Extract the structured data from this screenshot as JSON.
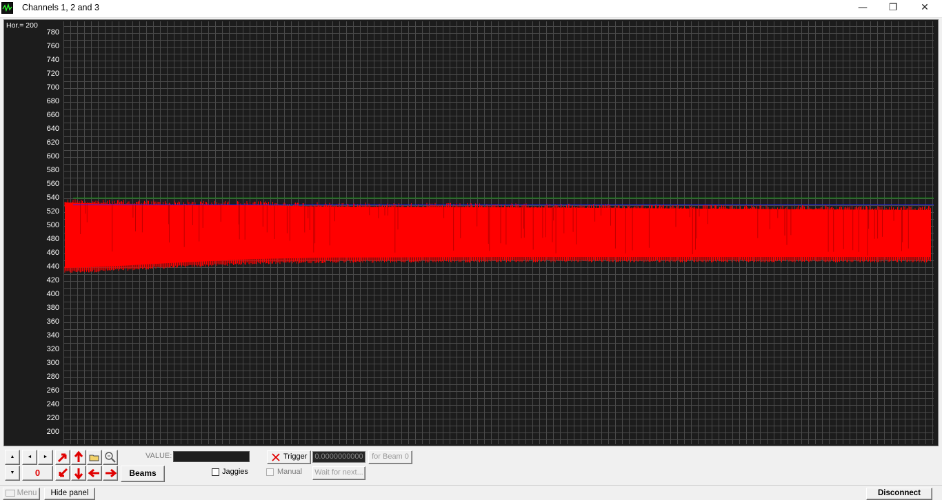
{
  "window": {
    "title": "Channels 1, 2 and 3",
    "icon": "oscilloscope-icon",
    "minimize_glyph": "—",
    "restore_glyph": "❐",
    "close_glyph": "✕"
  },
  "scope": {
    "hor_label": "Hor.= 200",
    "y_ticks": [
      "780",
      "760",
      "740",
      "720",
      "700",
      "680",
      "660",
      "640",
      "620",
      "600",
      "580",
      "560",
      "540",
      "520",
      "500",
      "480",
      "460",
      "440",
      "420",
      "400",
      "380",
      "360",
      "340",
      "320",
      "300",
      "280",
      "260",
      "240",
      "220",
      "200"
    ],
    "background_color": "#1c1c1c",
    "grid_color": "#4a4a4a",
    "chart_data": {
      "type": "line",
      "y_range": [
        190,
        790
      ],
      "grid": true,
      "series": [
        {
          "color": "#ff0000",
          "band_min": [
            431,
            433,
            438,
            444,
            446,
            447,
            447,
            447
          ],
          "band_max": [
            540,
            538,
            537,
            536,
            534,
            533,
            531,
            529
          ],
          "band_x": [
            0,
            0.05,
            0.12,
            0.22,
            0.3,
            0.5,
            0.75,
            1.0
          ]
        },
        {
          "color": "#00b000",
          "level": 541
        },
        {
          "color": "#2020ff",
          "level": 531
        }
      ]
    }
  },
  "panel": {
    "beam_number": "0",
    "beams_label": "Beams",
    "value_label": "VALUE:",
    "jaggies_label": "Jaggies",
    "trigger_label": "Trigger",
    "trigger_value": "0.0000000000",
    "for_beam_label": "for Beam 0",
    "manual_label": "Manual",
    "wait_label": "Wait for next...",
    "scroll_up": "▲",
    "scroll_down": "▼",
    "left_glyph": "◄",
    "right_glyph": "►"
  },
  "footer": {
    "menu_label": "Menu",
    "hide_panel_label": "Hide panel",
    "disconnect_label": "Disconnect"
  }
}
